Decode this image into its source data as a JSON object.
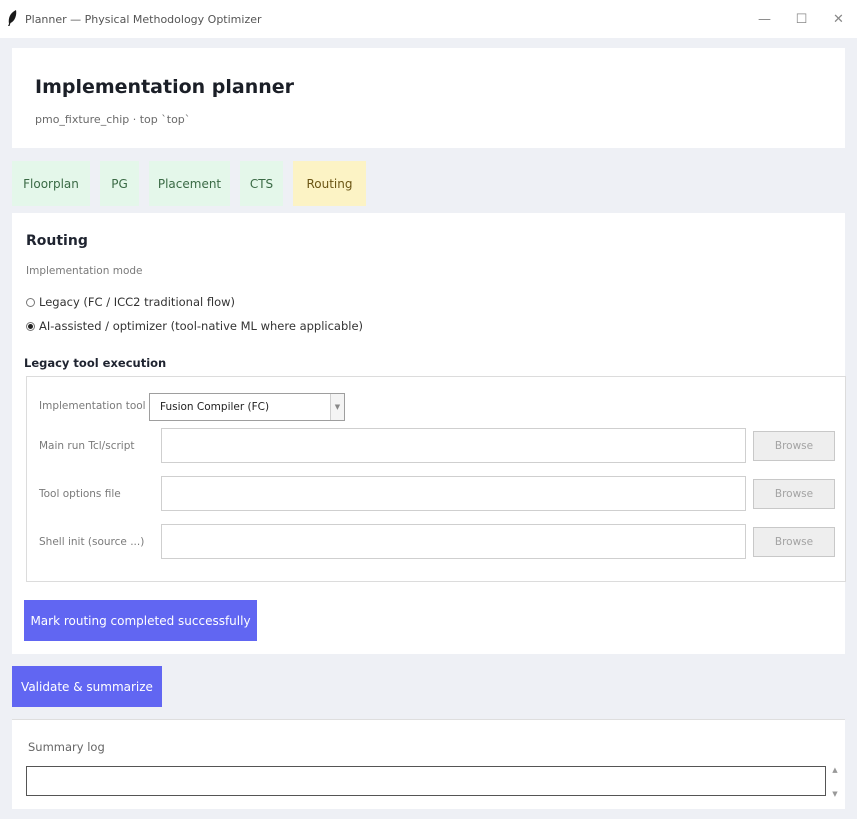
{
  "window": {
    "title": "Planner — Physical Methodology Optimizer",
    "app_icon": "feather-icon",
    "controls": {
      "minimize": "—",
      "maximize": "☐",
      "close": "✕"
    }
  },
  "header": {
    "title": "Implementation planner",
    "subtitle": "pmo_fixture_chip · top `top`"
  },
  "tabs": [
    {
      "label": "Floorplan",
      "active": false
    },
    {
      "label": "PG",
      "active": false
    },
    {
      "label": "Placement",
      "active": false
    },
    {
      "label": "CTS",
      "active": false
    },
    {
      "label": "Routing",
      "active": true
    }
  ],
  "routing": {
    "title": "Routing",
    "mode_label": "Implementation mode",
    "modes": [
      {
        "label": "Legacy (FC / ICC2 traditional flow)",
        "checked": false
      },
      {
        "label": "AI-assisted / optimizer (tool-native ML where applicable)",
        "checked": true
      }
    ],
    "legacy_title": "Legacy tool execution",
    "tool_label": "Implementation tool",
    "tool_value": "Fusion Compiler (FC)",
    "fields": [
      {
        "label": "Main run Tcl/script",
        "value": "",
        "browse": "Browse"
      },
      {
        "label": "Tool options file",
        "value": "",
        "browse": "Browse"
      },
      {
        "label": "Shell init (source ...)",
        "value": "",
        "browse": "Browse"
      }
    ],
    "mark_button": "Mark routing completed successfully"
  },
  "validate_button": "Validate & summarize",
  "summary": {
    "label": "Summary log",
    "value": ""
  },
  "colors": {
    "accent": "#6166f2",
    "tab_done_bg": "#e4f7ea",
    "tab_active_bg": "#fcf3c5",
    "page_bg": "#eef0f5"
  }
}
